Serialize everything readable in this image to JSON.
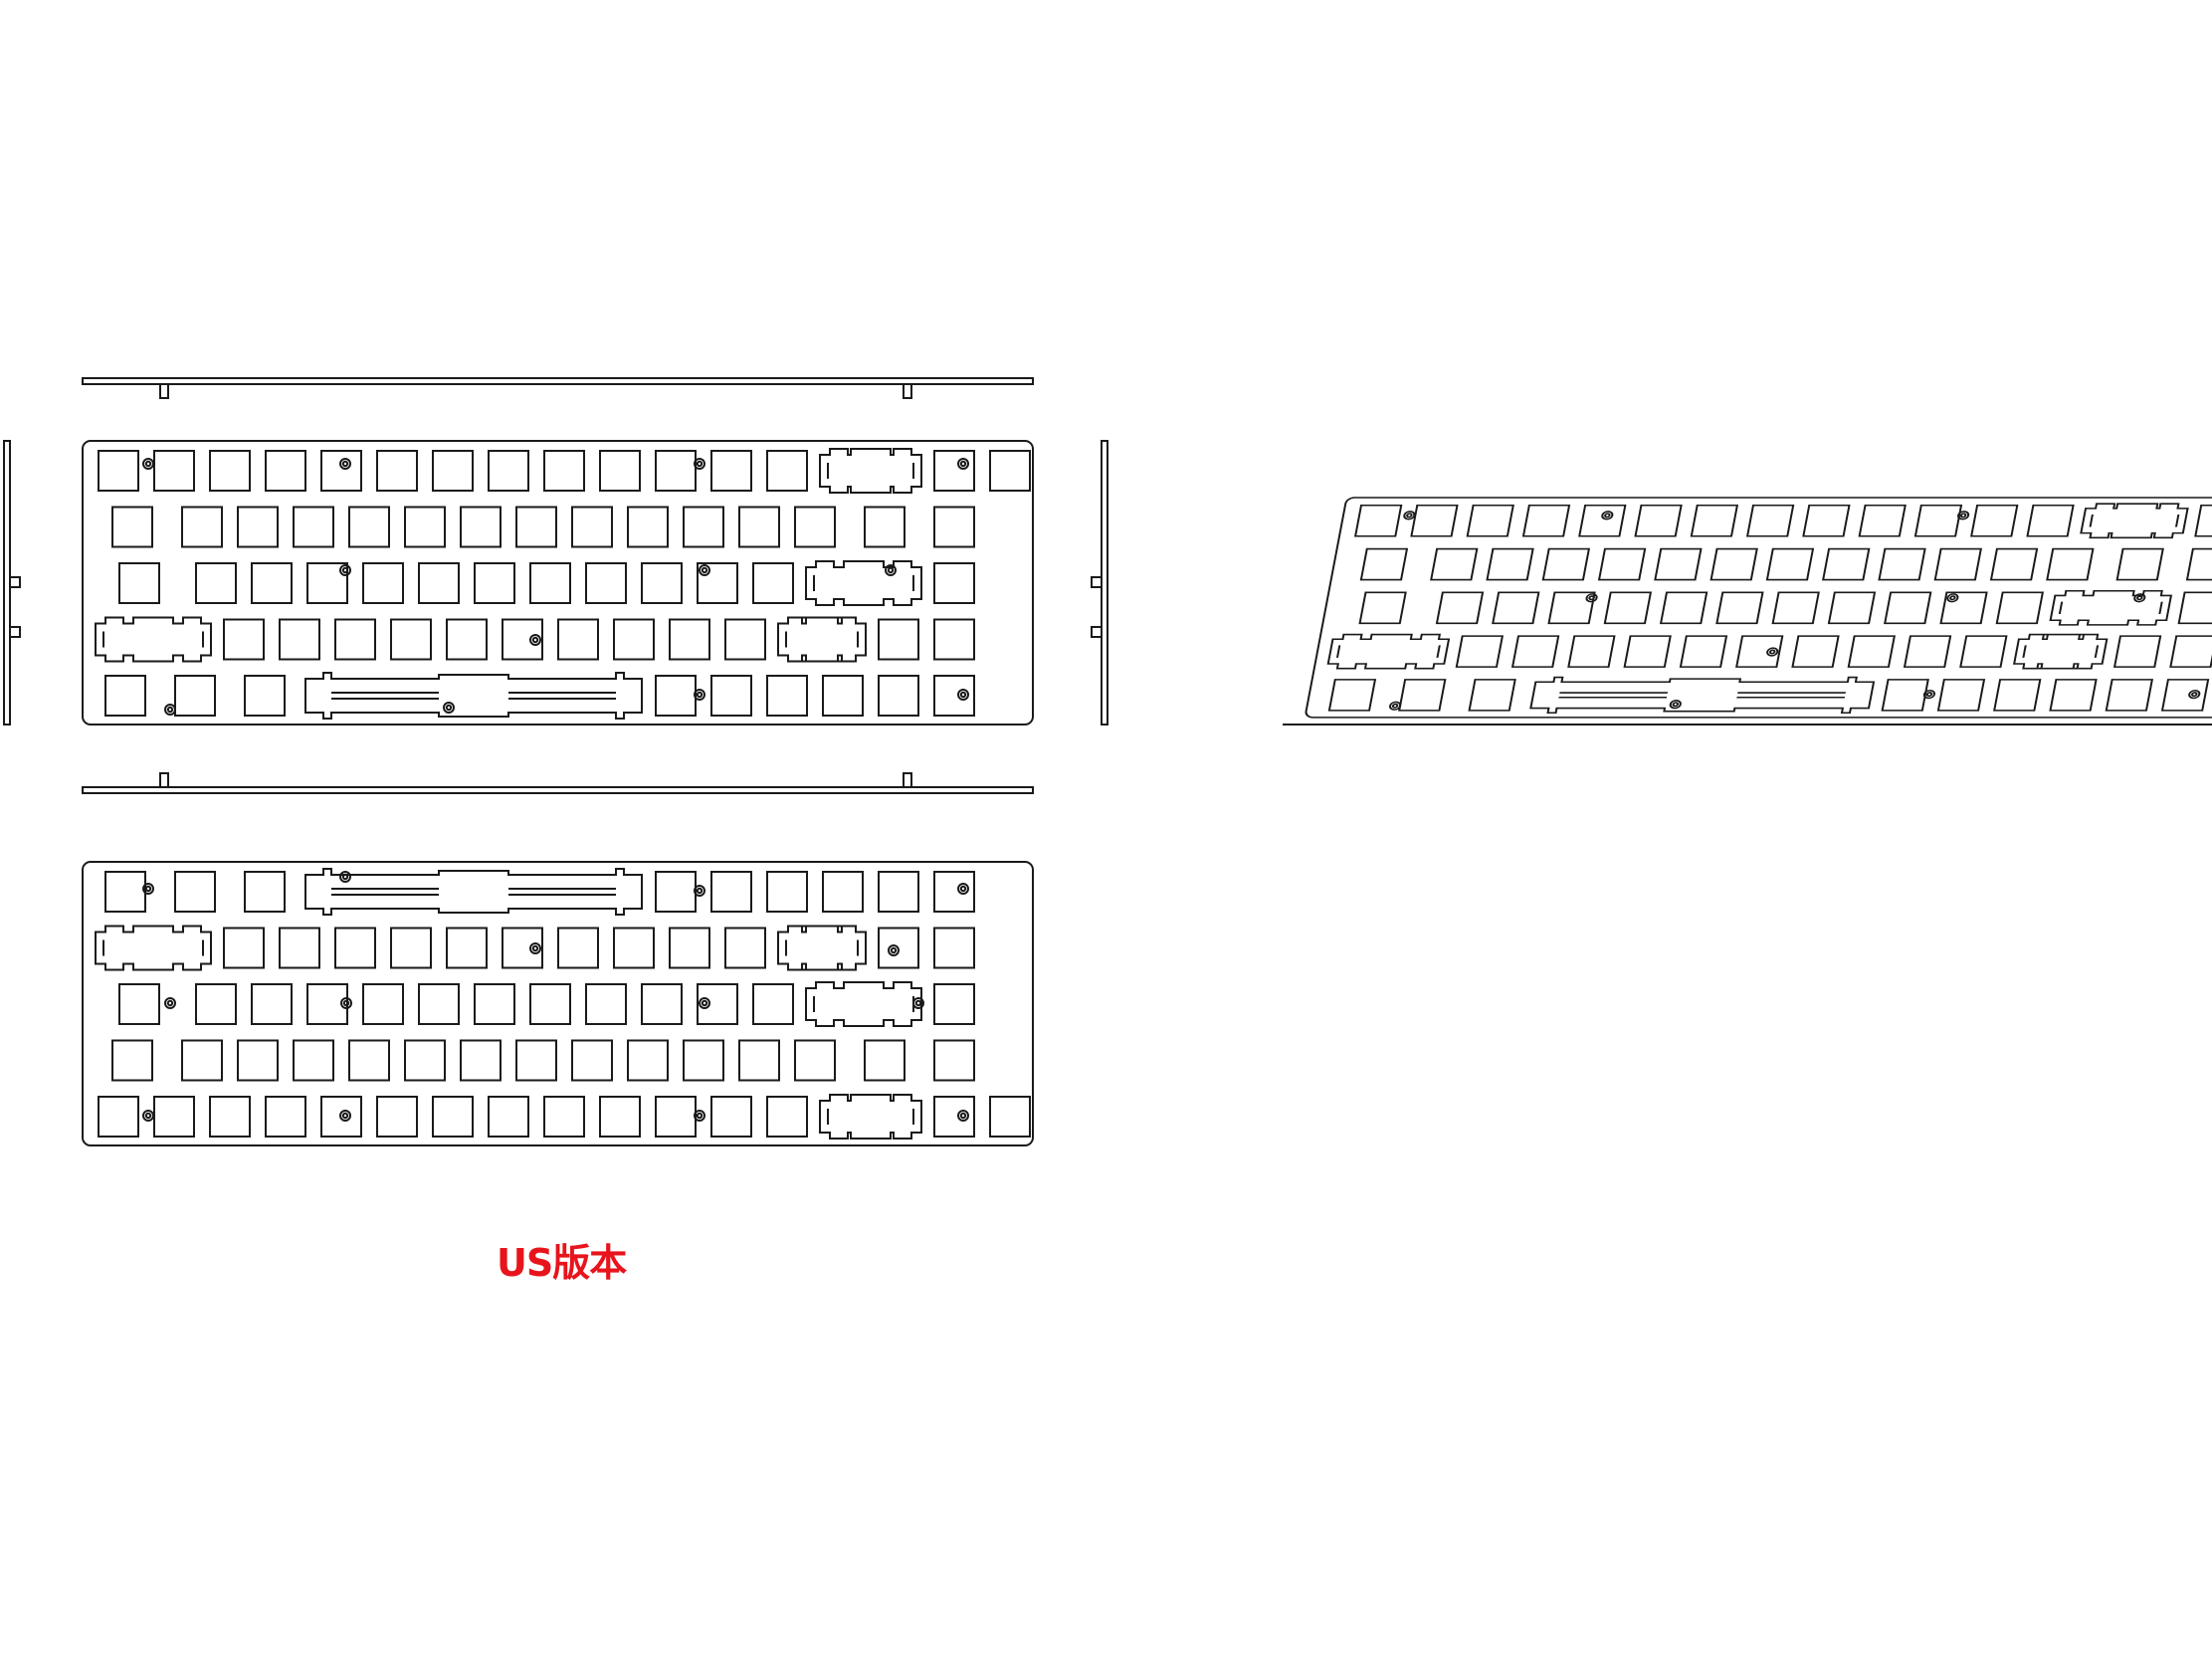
{
  "caption": {
    "text": "US版本",
    "color": "#e8141c"
  },
  "line_color": "#1a1a1a",
  "views": [
    "side-top",
    "front",
    "side-left",
    "side-right",
    "side-bottom",
    "back",
    "isometric"
  ],
  "layout": {
    "rows": [
      16,
      15,
      15,
      14,
      14
    ],
    "stabilizer_keys": [
      "backspace",
      "enter",
      "left-shift",
      "right-shift",
      "spacebar"
    ]
  }
}
